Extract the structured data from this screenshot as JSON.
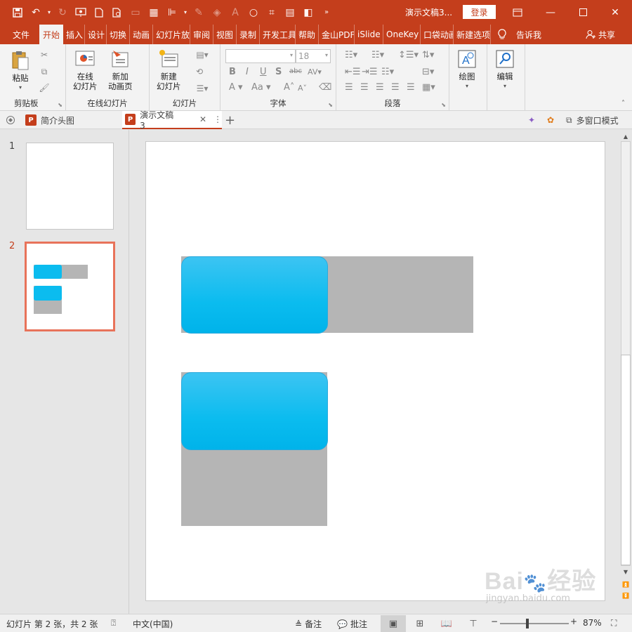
{
  "title_bar": {
    "document_title": "演示文稿3...",
    "login_label": "登录"
  },
  "tabs": {
    "file": "文件",
    "items": [
      "开始",
      "插入",
      "设计",
      "切换",
      "动画",
      "幻灯片放",
      "审阅",
      "视图",
      "录制",
      "开发工具",
      "帮助",
      "金山PDF",
      "iSlide",
      "OneKey",
      "口袋动画",
      "新建选项"
    ],
    "tell_me": "告诉我",
    "share": "共享"
  },
  "ribbon": {
    "clipboard": {
      "paste": "粘贴",
      "group": "剪贴板"
    },
    "online_slides": {
      "online": "在线\n幻灯片",
      "new_anim": "新加\n动画页",
      "group": "在线幻灯片"
    },
    "slides": {
      "new_slide": "新建\n幻灯片",
      "group": "幻灯片"
    },
    "font": {
      "font_name": "",
      "font_size": "18",
      "group": "字体"
    },
    "paragraph": {
      "group": "段落"
    },
    "drawing": {
      "label": "绘图"
    },
    "editing": {
      "label": "编辑"
    }
  },
  "doc_tabs": {
    "tab1": "简介头图",
    "tab2": "演示文稿3",
    "multi_window": "多窗口模式"
  },
  "thumbnails": [
    {
      "number": "1"
    },
    {
      "number": "2"
    }
  ],
  "status_bar": {
    "slide_info": "幻灯片 第 2 张，共 2 张",
    "language": "中文(中国)",
    "notes": "备注",
    "comments": "批注",
    "zoom": "87%"
  },
  "watermark": {
    "logo": "Bai du 经验",
    "url": "jingyan.baidu.com"
  },
  "colors": {
    "accent": "#c43e1c",
    "shape_blue": "#00bcf2",
    "shape_gray": "#b5b5b5",
    "selected_thumb_border": "#e8735a"
  }
}
